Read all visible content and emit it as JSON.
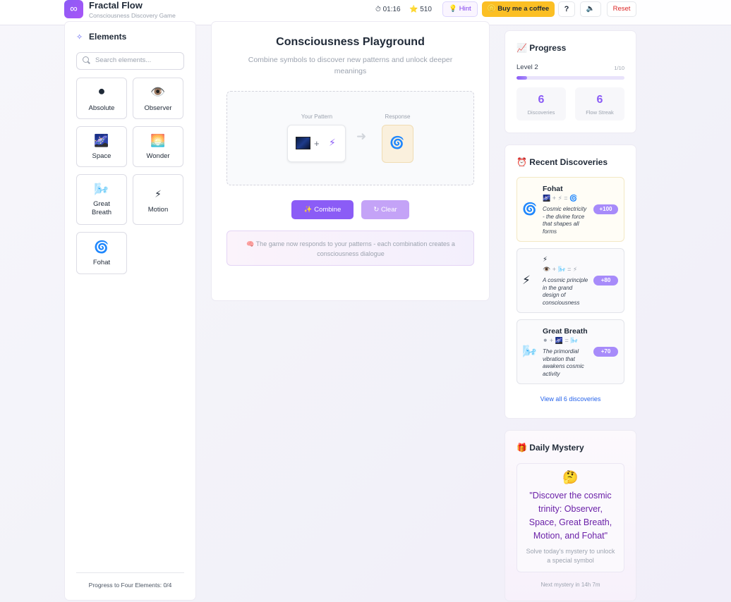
{
  "header": {
    "logo_glyph": "∞",
    "title": "Fractal Flow",
    "subtitle": "Consciousness Discovery Game",
    "timer": "⏱ 01:16",
    "score": "⭐ 510",
    "hint_label": "💡 Hint",
    "coffee_label": "🪙 Buy me a coffee",
    "help_label": "?",
    "sound_label": "🔈",
    "reset_label": "Reset"
  },
  "sidebar": {
    "title_icon": "✧",
    "title": "Elements",
    "search_placeholder": "Search elements...",
    "elements": [
      {
        "name": "Absolute",
        "glyph": "⚫"
      },
      {
        "name": "Observer",
        "glyph": "👁️"
      },
      {
        "name": "Space",
        "glyph": "🌌"
      },
      {
        "name": "Wonder",
        "glyph": "🌅"
      },
      {
        "name": "Great Breath",
        "glyph": "🌬️"
      },
      {
        "name": "Motion",
        "glyph": "⚡"
      },
      {
        "name": "Fohat",
        "glyph": "🌀"
      }
    ],
    "footer": "Progress to Four Elements: 0/4"
  },
  "playground": {
    "title": "Consciousness Playground",
    "subtitle": "Combine symbols to discover new patterns and unlock deeper meanings",
    "pattern_label": "Your Pattern",
    "response_label": "Response",
    "pattern_plus": "+",
    "pattern_second_glyph": "⚡",
    "arrow": "➜",
    "response_glyph": "🌀",
    "combine_label": "✨ Combine",
    "clear_label": "↻ Clear",
    "info_text": "🧠 The game now responds to your patterns - each combination creates a consciousness dialogue"
  },
  "progress": {
    "title": "📈 Progress",
    "level": "Level 2",
    "level_count": "1/10",
    "level_fraction": 0.1,
    "discoveries_value": "6",
    "discoveries_label": "Discoveries",
    "streak_value": "6",
    "streak_label": "Flow Streak"
  },
  "recent": {
    "title": "⏰ Recent Discoveries",
    "items": [
      {
        "icon": "🌀",
        "name": "Fohat",
        "recipe": "🌌 + ⚡ = 🌀",
        "description": "Cosmic electricity - the divine force that shapes all forms",
        "points": "+100"
      },
      {
        "icon": "⚡",
        "name": "⚡",
        "recipe": "👁️ + 🌬️ = ⚡",
        "description": "A cosmic principle in the grand design of consciousness",
        "points": "+80"
      },
      {
        "icon": "🌬️",
        "name": "Great Breath",
        "recipe": "⚫ + 🌌 = 🌬️",
        "description": "The primordial vibration that awakens cosmic activity",
        "points": "+70"
      }
    ],
    "view_all": "View all 6 discoveries"
  },
  "mystery": {
    "title": "🎁 Daily Mystery",
    "emoji": "🤔",
    "quote": "\"Discover the cosmic trinity: Observer, Space, Great Breath, Motion, and Fohat\"",
    "hint": "Solve today's mystery to unlock a special symbol",
    "next": "Next mystery in 14h 7m"
  },
  "colors": {
    "accent": "#8b5cf6",
    "coffee": "#fbbf24",
    "reset": "#dc2626",
    "link": "#2563eb"
  }
}
